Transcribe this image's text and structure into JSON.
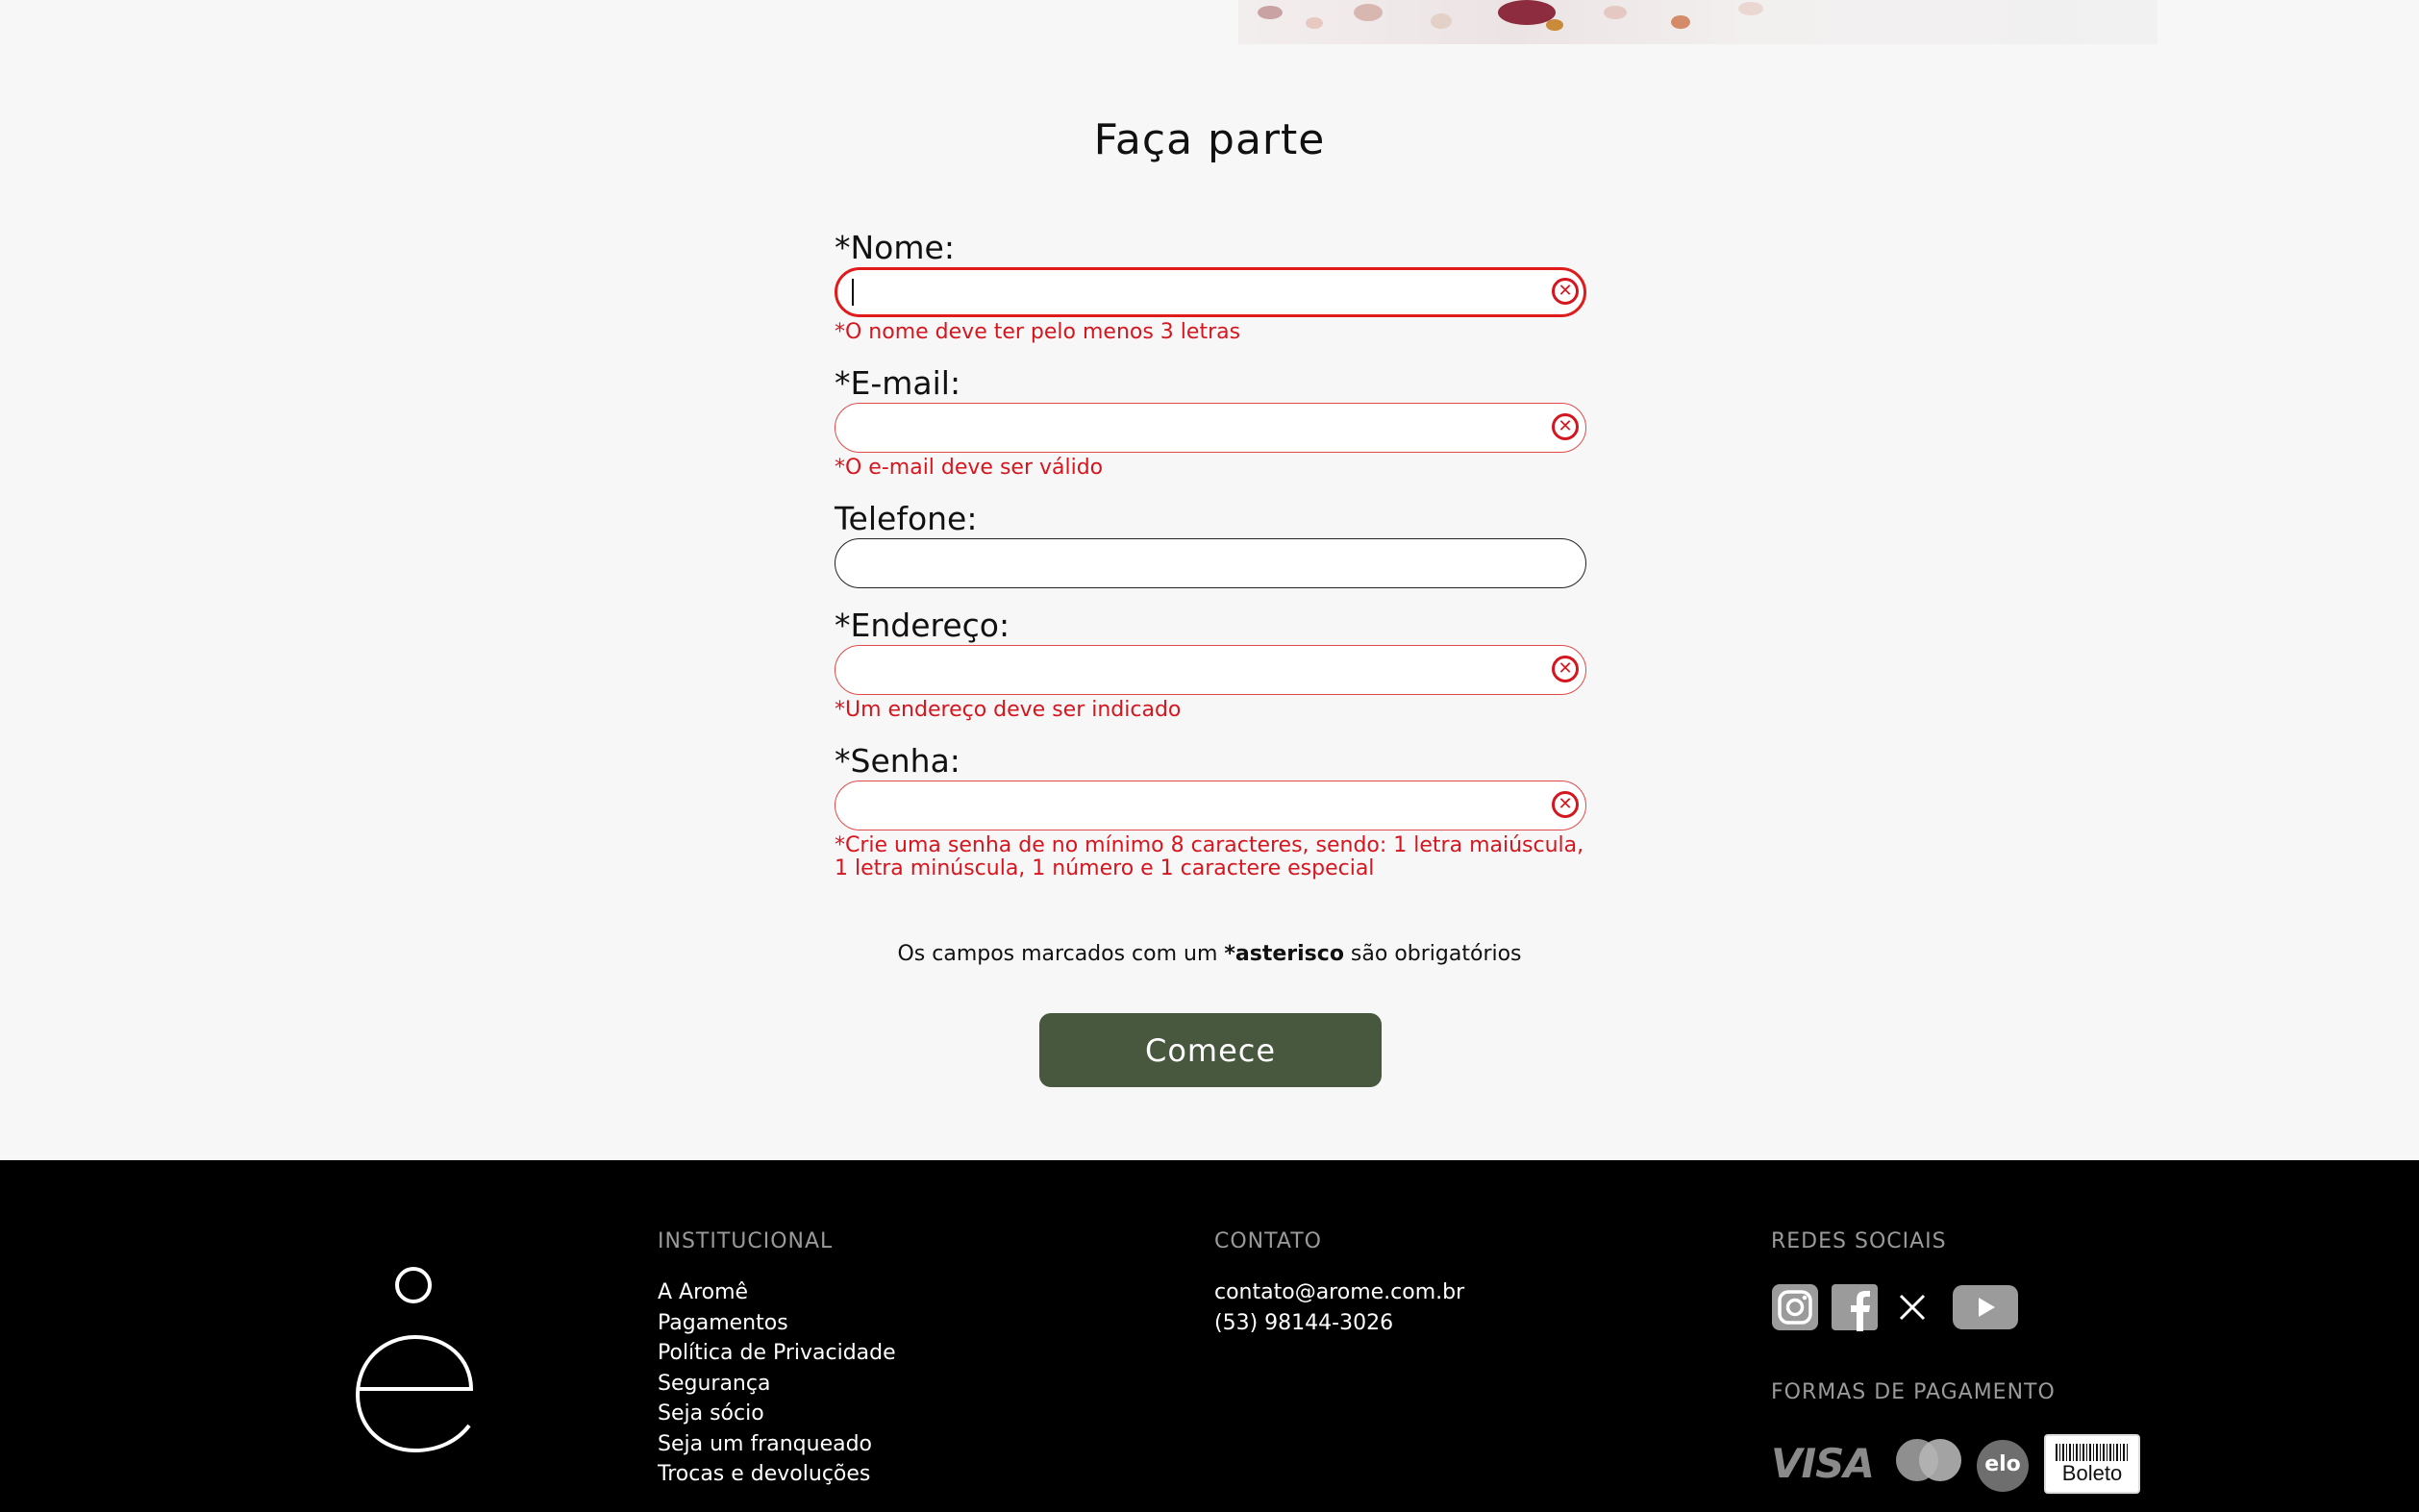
{
  "form": {
    "title": "Faça parte",
    "fields": [
      {
        "label": "*Nome:",
        "value": "",
        "error": "*O nome deve ter pelo menos 3 letras"
      },
      {
        "label": "*E-mail:",
        "value": "",
        "error": "*O e-mail deve ser válido"
      },
      {
        "label": "Telefone:",
        "value": "",
        "error": ""
      },
      {
        "label": "*Endereço:",
        "value": "",
        "error": "*Um endereço deve ser indicado"
      },
      {
        "label": "*Senha:",
        "value": "",
        "error": "*Crie uma senha de no mínimo 8 caracteres, sendo: 1 letra maiúscula, 1 letra minúscula, 1 número e 1 caractere especial"
      }
    ],
    "required_note_prefix": "Os campos marcados com um ",
    "required_note_bold": "*asterisco",
    "required_note_suffix": " são obrigatórios",
    "submit_label": "Comece",
    "error_color": "#d6161f",
    "button_color": "#47583f"
  },
  "footer": {
    "institutional": {
      "heading": "INSTITUCIONAL",
      "links": [
        "A Aromê",
        "Pagamentos",
        "Política de Privacidade",
        "Segurança",
        "Seja sócio",
        "Seja um franqueado",
        "Trocas e devoluções"
      ]
    },
    "contact": {
      "heading": "CONTATO",
      "email": "contato@arome.com.br",
      "phone": "(53) 98144-3026"
    },
    "social": {
      "heading": "REDES SOCIAIS",
      "icons": [
        "instagram-icon",
        "facebook-icon",
        "x-icon",
        "youtube-icon"
      ]
    },
    "payments": {
      "heading": "FORMAS DE PAGAMENTO",
      "visa": "VISA",
      "elo": "elo",
      "boleto": "Boleto"
    }
  }
}
